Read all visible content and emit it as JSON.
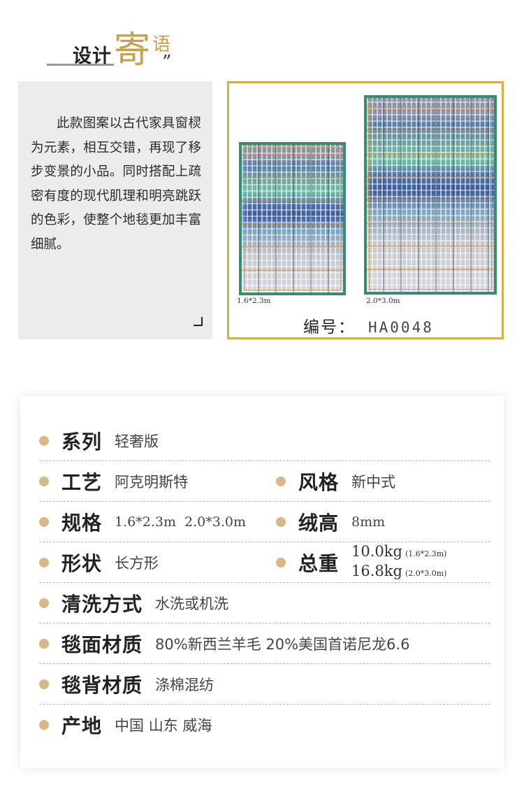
{
  "header": {
    "title_part1": "设计",
    "title_part2": "寄",
    "title_part3": "语",
    "quote_mark": "”"
  },
  "description": {
    "text": "此款图案以古代家具窗棂为元素，相互交错，再现了移步变景的小品。同时搭配上疏密有度的现代肌理和明亮跳跃的色彩，使整个地毯更加丰富细腻。"
  },
  "product": {
    "small_size": "1.6*2.3m",
    "large_size": "2.0*3.0m",
    "code_label": "编号：",
    "code_value": "HA0048"
  },
  "specs": {
    "series": {
      "label": "系列",
      "value": "轻奢版"
    },
    "craft": {
      "label": "工艺",
      "value": "阿克明斯特"
    },
    "style": {
      "label": "风格",
      "value": "新中式"
    },
    "size": {
      "label": "规格",
      "value": "1.6*2.3m  2.0*3.0m"
    },
    "pile": {
      "label": "绒高",
      "value": "8mm"
    },
    "shape": {
      "label": "形状",
      "value": "长方形"
    },
    "weight": {
      "label": "总重",
      "value1": "10.0kg",
      "note1": "(1.6*2.3m)",
      "value2": "16.8kg",
      "note2": "(2.0*3.0m)"
    },
    "cleaning": {
      "label": "清洗方式",
      "value": "水洗或机洗"
    },
    "face": {
      "label": "毯面材质",
      "value": "80%新西兰羊毛 20%美国首诺尼龙6.6"
    },
    "back": {
      "label": "毯背材质",
      "value": "涤棉混纺"
    },
    "origin": {
      "label": "产地",
      "value": "中国 山东 威海"
    }
  },
  "colors": {
    "gold": "#d9ae45",
    "accent_text": "#c9a047",
    "dot": "#d9b887",
    "rug_border": "#3d8a72"
  }
}
